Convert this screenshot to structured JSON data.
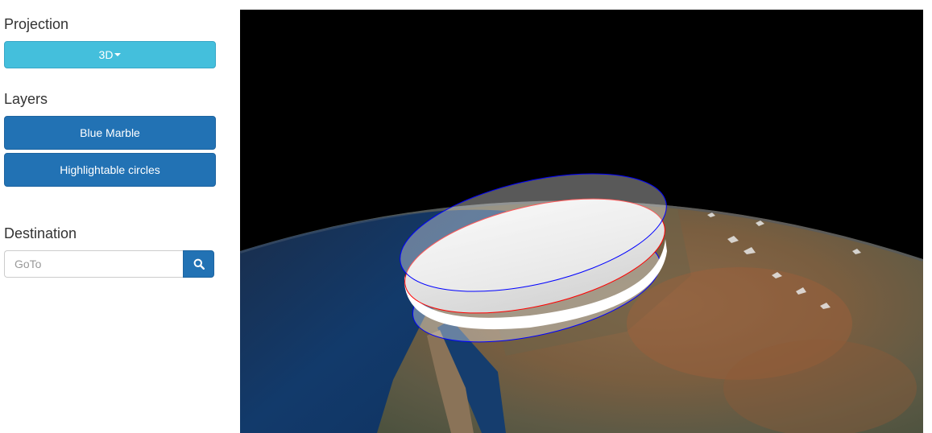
{
  "sidebar": {
    "projection": {
      "title": "Projection",
      "dropdown_label": "3D"
    },
    "layers": {
      "title": "Layers",
      "items": [
        "Blue Marble",
        "Highlightable circles"
      ]
    },
    "destination": {
      "title": "Destination",
      "placeholder": "GoTo"
    }
  },
  "globe": {
    "space_color": "#000000",
    "circle_outline_colors": [
      "#0000ff",
      "#ff0000"
    ],
    "circle_fill_color": "#ffffff"
  }
}
